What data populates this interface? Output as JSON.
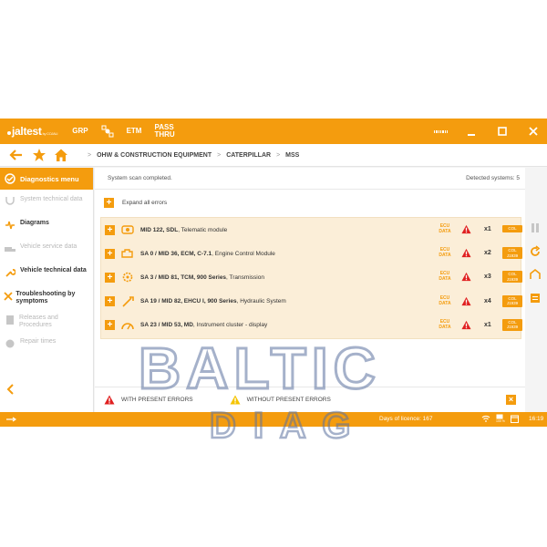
{
  "app": {
    "logo": "jaltest",
    "logo_sub": "by COJALI",
    "top_tabs": [
      "GRP",
      "ETM",
      "PASS THRU"
    ]
  },
  "breadcrumb": [
    "OHW & CONSTRUCTION EQUIPMENT",
    "CATERPILLAR",
    "MSS"
  ],
  "sidebar": {
    "header": "Diagnostics menu",
    "items": [
      {
        "label": "System technical data",
        "enabled": false,
        "icon": "stethoscope-icon"
      },
      {
        "label": "Diagrams",
        "enabled": true,
        "icon": "diagram-icon"
      },
      {
        "label": "Vehicle service data",
        "enabled": false,
        "icon": "truck-icon"
      },
      {
        "label": "Vehicle technical data",
        "enabled": true,
        "icon": "wrench-icon"
      },
      {
        "label": "Troubleshooting by symptoms",
        "enabled": true,
        "icon": "tools-icon"
      },
      {
        "label": "Releases and Procedures",
        "enabled": false,
        "icon": "document-icon"
      },
      {
        "label": "Repair times",
        "enabled": false,
        "icon": "gear-clock-icon"
      }
    ]
  },
  "main": {
    "status": "System scan completed.",
    "detected": "Detected systems: 5",
    "expand_all": "Expand all errors",
    "systems": [
      {
        "bold": "MID 122, SDL",
        "rest": ", Telematic module",
        "count": "x1",
        "col": [
          "COL"
        ]
      },
      {
        "bold": "SA 0 / MID 36, ECM, C-7.1",
        "rest": ", Engine Control Module",
        "count": "x2",
        "col": [
          "COL",
          "J1939"
        ]
      },
      {
        "bold": "SA 3 / MID 81, TCM, 900 Series",
        "rest": ", Transmission",
        "count": "x3",
        "col": [
          "COL",
          "J1939"
        ]
      },
      {
        "bold": "SA 19 / MID 82, EHCU I, 900 Series",
        "rest": ", Hydraulic System",
        "count": "x4",
        "col": [
          "COL",
          "J1939"
        ]
      },
      {
        "bold": "SA 23 / MID 53, MD",
        "rest": ", Instrument cluster - display",
        "count": "x1",
        "col": [
          "COL",
          "J1939"
        ]
      }
    ],
    "ecu_label": [
      "ECU",
      "DATA"
    ],
    "legend": {
      "with_errors": "WITH PRESENT ERRORS",
      "without_errors": "WITHOUT PRESENT ERRORS"
    }
  },
  "statusbar": {
    "licence": "Days of licence: 167",
    "battery": "100 %",
    "time": "16:19"
  },
  "watermark": {
    "line1": "BALTIC",
    "line2": "D I A G"
  },
  "colors": {
    "accent": "#f49c0e",
    "error": "#e02020",
    "warning": "#f5c400",
    "row_bg": "#fbeed8"
  }
}
